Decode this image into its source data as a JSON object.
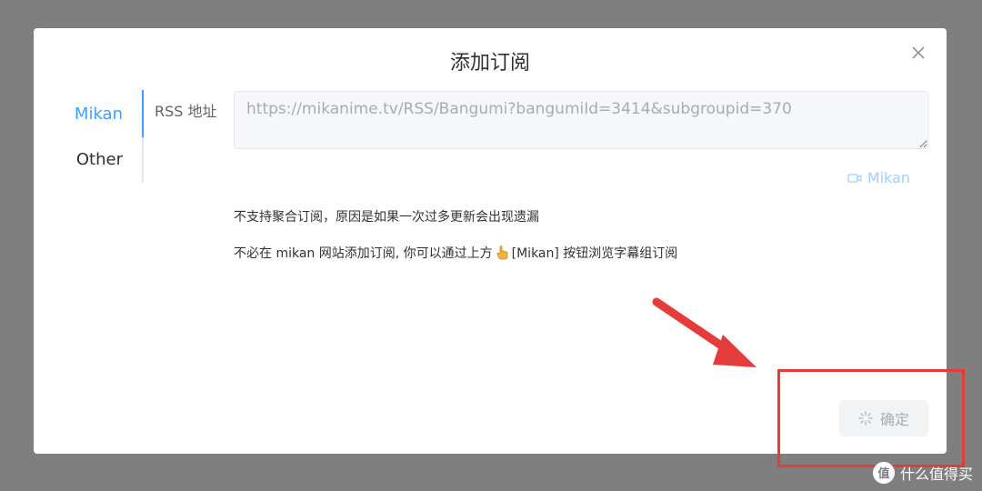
{
  "dialog": {
    "title": "添加订阅",
    "close_icon": "close-icon"
  },
  "tabs": [
    {
      "label": "Mikan",
      "active": true
    },
    {
      "label": "Other",
      "active": false
    }
  ],
  "form": {
    "rss_label": "RSS 地址",
    "rss_value": "https://mikanime.tv/RSS/Bangumi?bangumiId=3414&subgroupid=370",
    "mikan_link_label": "Mikan",
    "mikan_link_icon": "video-camera-icon"
  },
  "notes": {
    "line1": "不支持聚合订阅，原因是如果一次过多更新会出现遗漏",
    "line2_before": "不必在 mikan 网站添加订阅, 你可以通过上方",
    "line2_icon": "pointing-hand-icon",
    "line2_after": "[Mikan] 按钮浏览字幕组订阅"
  },
  "footer": {
    "confirm_label": "确定",
    "confirm_icon": "loading-spinner-icon",
    "confirm_state": "loading"
  },
  "watermark": {
    "text": "什么值得买"
  },
  "colors": {
    "overlay": "#7f7f7f",
    "accent": "#409eff",
    "annotation": "#e63b3b"
  }
}
